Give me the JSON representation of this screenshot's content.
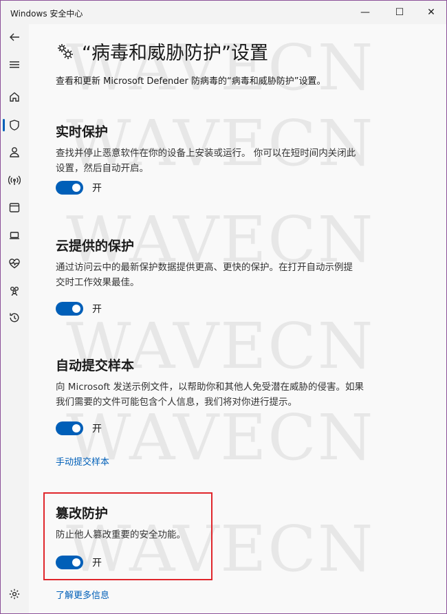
{
  "window": {
    "title": "Windows 安全中心",
    "minimize": "—",
    "maximize": "☐",
    "close": "✕"
  },
  "sidebar": {
    "items": [
      {
        "name": "back-icon"
      },
      {
        "name": "menu-icon"
      },
      {
        "name": "home-icon"
      },
      {
        "name": "shield-icon",
        "active": true
      },
      {
        "name": "person-icon"
      },
      {
        "name": "wireless-icon"
      },
      {
        "name": "app-browser-icon"
      },
      {
        "name": "device-icon"
      },
      {
        "name": "heart-pulse-icon"
      },
      {
        "name": "family-icon"
      },
      {
        "name": "history-icon"
      },
      {
        "name": "settings-icon"
      }
    ]
  },
  "page": {
    "icon": "gear-icon",
    "title": "“病毒和威胁防护”设置",
    "subtitle": "查看和更新 Microsoft Defender 防病毒的“病毒和威胁防护”设置。"
  },
  "sections": [
    {
      "title": "实时保护",
      "desc_line1": "查找并停止恶意软件在你的设备上安装或运行。 你可以在短时间内关闭此",
      "desc_line2": "设置，然后自动开启。",
      "toggle_state": "开"
    },
    {
      "title": "云提供的保护",
      "desc_line1": "通过访问云中的最新保护数据提供更高、更快的保护。在打开自动示例提",
      "desc_line2": "交时工作效果最佳。",
      "toggle_state": "开"
    },
    {
      "title": "自动提交样本",
      "desc_line1": "向 Microsoft 发送示例文件，以帮助你和其他人免受潜在威胁的侵害。如果",
      "desc_line2": "我们需要的文件可能包含个人信息，我们将对你进行提示。",
      "toggle_state": "开",
      "link": "手动提交样本"
    },
    {
      "title": "篡改防护",
      "desc_line1": "防止他人篡改重要的安全功能。",
      "toggle_state": "开",
      "link": "了解更多信息"
    }
  ],
  "watermark": "WAVECN",
  "colors": {
    "accent": "#005fb8",
    "highlight": "#e0252b",
    "window_border": "#8a4f98"
  }
}
